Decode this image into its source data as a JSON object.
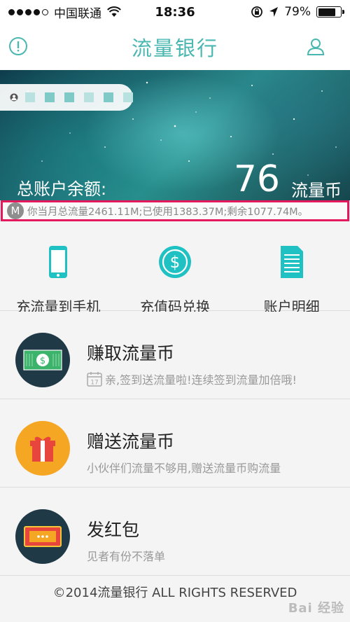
{
  "status_bar": {
    "carrier": "中国联通",
    "time": "18:36",
    "battery_percent": "79%",
    "battery_level": 0.79,
    "icons": [
      "signal-dots-icon",
      "wifi-icon",
      "orientation-lock-icon",
      "location-arrow-icon",
      "battery-icon"
    ]
  },
  "nav": {
    "title": "流量银行",
    "left_icon": "info-icon",
    "right_icon": "user-icon"
  },
  "account": {
    "user_icon": "avatar-icon",
    "balance_label": "总账户余额:",
    "balance_value": "76",
    "balance_unit": "流量币"
  },
  "usage": {
    "badge": "M",
    "text": "你当月总流量2461.11M;已使用1383.37M;剩余1077.74M。"
  },
  "quick_actions": [
    {
      "label": "充流量到手机",
      "icon": "phone-icon"
    },
    {
      "label": "充值码兑换",
      "icon": "dollar-coin-icon"
    },
    {
      "label": "账户明细",
      "icon": "document-list-icon"
    }
  ],
  "list": [
    {
      "title": "赚取流量币",
      "subtitle": "亲,签到送流量啦!连续签到流量加倍哦!",
      "icon": "money-bill-icon",
      "sub_icon": "calendar-17-icon",
      "calendar_day": "17"
    },
    {
      "title": "赠送流量币",
      "subtitle": "小伙伴们流量不够用,赠送流量币购流量",
      "icon": "gift-icon"
    },
    {
      "title": "发红包",
      "subtitle": "见者有份不落单",
      "icon": "red-envelope-icon"
    }
  ],
  "footer": {
    "text": "©2014流量银行 ALL RIGHTS RESERVED",
    "watermark": "Bai 经验"
  },
  "colors": {
    "accent": "#4ab8b1",
    "highlight_border": "#e4185c",
    "dark_circle": "#1f3a46",
    "orange_circle": "#f5a623"
  }
}
